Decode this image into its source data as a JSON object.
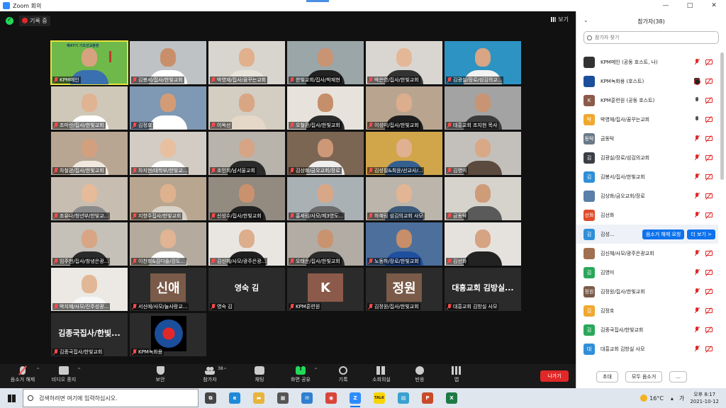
{
  "window": {
    "title": "Zoom 회의",
    "controls": [
      "—",
      "□",
      "✕"
    ]
  },
  "meeting": {
    "recording_label": "기록 중",
    "view_label": "보기",
    "active_tile_text": "제47기 기초선교훈련",
    "tiles": [
      {
        "caption": "KPM메인",
        "type": "video",
        "skin": "#d7a27f",
        "bg": "#6fb84a",
        "body": "#3a6fb0"
      },
      {
        "caption": "김봉서/집사/한빛교회",
        "type": "video",
        "skin": "#c98f6a",
        "bg": "#bfc2c4",
        "body": "#ffffff"
      },
      {
        "caption": "박영재/집사/꿈꾸는교회",
        "type": "video",
        "skin": "#e1b08c",
        "bg": "#d8d5cf",
        "body": "#e8e4dc"
      },
      {
        "caption": "한빛교회/집사/박재현",
        "type": "video",
        "skin": "#c89474",
        "bg": "#9aa6a8",
        "body": "#222222"
      },
      {
        "caption": "박은영/집사/한빛교회",
        "type": "video",
        "skin": "#e4b896",
        "bg": "#d9d6d2",
        "body": "#333333"
      },
      {
        "caption": "김광실/장로/섬김의교...",
        "type": "video",
        "skin": "#d8a585",
        "bg": "#2d93c2",
        "body": "#f2f2f2"
      },
      {
        "caption": "조미란/집사/한빛교회",
        "type": "video",
        "skin": "#e0b393",
        "bg": "#cfc8b8",
        "body": "#ffffff"
      },
      {
        "caption": "김정호",
        "type": "video",
        "skin": "#d39c77",
        "bg": "#7f98b4",
        "body": "#ffffff"
      },
      {
        "caption": "이옥선",
        "type": "video",
        "skin": "#d9a684",
        "bg": "#d3cdc2",
        "body": "#e6d8c8"
      },
      {
        "caption": "오철환/집사/한빛교회",
        "type": "video",
        "skin": "#c68f6b",
        "bg": "#e7e3dc",
        "body": "#2b2b2b"
      },
      {
        "caption": "이성미/집사/한빛교회",
        "type": "video",
        "skin": "#dcae8d",
        "bg": "#b9a58f",
        "body": "#1f1f1f"
      },
      {
        "caption": "대흥교회 조지현 목사",
        "type": "video",
        "skin": "#c99473",
        "bg": "#a3a3a3",
        "body": "#3b3b3b"
      },
      {
        "caption": "차철환/집사/한빛교회",
        "type": "video",
        "skin": "#d2a07f",
        "bg": "#b8a693",
        "body": "#f1e8df"
      },
      {
        "caption": "차지현/대학부/한빛교...",
        "type": "video",
        "skin": "#e8c0a0",
        "bg": "#d2ccc4",
        "body": "#ffffff"
      },
      {
        "caption": "조인희/남서울교회",
        "type": "video",
        "skin": "#d6a585",
        "bg": "#b8b3ab",
        "body": "#2a2a2a"
      },
      {
        "caption": "김상화/금오교회/장로",
        "type": "video",
        "skin": "#cd9878",
        "bg": "#7b6653",
        "body": "#efefef"
      },
      {
        "caption": "김성필&최윤/선교사/...",
        "type": "video",
        "skin": "#dfb190",
        "bg": "#d1a54a",
        "body": "#34608f"
      },
      {
        "caption": "김영미",
        "type": "video",
        "skin": "#d9a887",
        "bg": "#c3c0bc",
        "body": "#5b4a3e"
      },
      {
        "caption": "조유나/청년부/한빛교...",
        "type": "video",
        "skin": "#e6bb9a",
        "bg": "#c7bdb0",
        "body": "#8a8a8a"
      },
      {
        "caption": "지향주집사/한빛교회",
        "type": "video",
        "skin": "#dfb28f",
        "bg": "#b9a690",
        "body": "#d8d2c8"
      },
      {
        "caption": "신성수/집사/한빛교회",
        "type": "video",
        "skin": "#c9916e",
        "bg": "#938a80",
        "body": "#222222"
      },
      {
        "caption": "홍세림/사모/제3영도...",
        "type": "video",
        "skin": "#d8a787",
        "bg": "#aab1b5",
        "body": "#6b6b6b"
      },
      {
        "caption": "하혜림 섬김의교회 사모",
        "type": "video",
        "skin": "#e2b594",
        "bg": "#bcb5ab",
        "body": "#3c5a7a"
      },
      {
        "caption": "금동탁",
        "type": "video",
        "skin": "#cf9c7a",
        "bg": "#d6d3cd",
        "body": "#5a5a5a"
      },
      {
        "caption": "임주현/집사/창녕은광...",
        "type": "video",
        "skin": "#d8a585",
        "bg": "#c5c0b8",
        "body": "#2a2a2a"
      },
      {
        "caption": "이찬희&김다솔/강도...",
        "type": "video",
        "skin": "#e1b493",
        "bg": "#b4ab9e",
        "body": "#ffffff"
      },
      {
        "caption": "김신혜/사모/광주은광...",
        "type": "video",
        "skin": "#dcae8c",
        "bg": "#e9e6e2",
        "body": "#1f1f1f"
      },
      {
        "caption": "오태운/집사/한빛교회",
        "type": "video",
        "skin": "#c99370",
        "bg": "#b2aca4",
        "body": "#2c2c2c"
      },
      {
        "caption": "노동하/장로/한빛교회",
        "type": "video",
        "skin": "#c68e69",
        "bg": "#4d6f9c",
        "body": "#1f4f9f"
      },
      {
        "caption": "김선화",
        "type": "video",
        "skin": "#d6a383",
        "bg": "#e5e2de",
        "body": "#222222"
      },
      {
        "caption": "박지혜/사모/진주성광...",
        "type": "video",
        "skin": "#e2b796",
        "bg": "#ece9e4",
        "body": "#f7f7f7"
      },
      {
        "caption": "서신애/사모/늘사랑교...",
        "type": "avatar",
        "avatar_text": "신애",
        "avatar_bg": "#7a5a48"
      },
      {
        "caption": "영숙 김",
        "type": "name",
        "name_text": "영숙 김"
      },
      {
        "caption": "KPM훈련원",
        "type": "avatar",
        "avatar_text": "K",
        "avatar_bg": "#8c5a4a"
      },
      {
        "caption": "김정원/집사/한빛교회",
        "type": "avatar",
        "avatar_text": "정원",
        "avatar_bg": "#7a5a48"
      },
      {
        "caption": "대흥교회 김방실 사모",
        "type": "name",
        "name_text": "대흥교회 김방실..."
      },
      {
        "caption": "김종국집사/한빛교회",
        "type": "name",
        "name_text": "김종국집사/한빛..."
      },
      {
        "caption": "KPM녹화용",
        "type": "logo"
      }
    ]
  },
  "toolbar": {
    "items": [
      {
        "label": "음소거 해제",
        "icon": "mic-muted-icon",
        "caret": true
      },
      {
        "label": "비디오 중지",
        "icon": "video-camera-icon",
        "caret": true
      },
      {
        "label": "보안",
        "icon": "security-shield-icon",
        "caret": false
      },
      {
        "label": "참가자",
        "icon": "participants-icon",
        "caret": true
      },
      {
        "label": "채팅",
        "icon": "chat-icon",
        "caret": false
      },
      {
        "label": "화면 공유",
        "icon": "share-screen-icon",
        "caret": true
      },
      {
        "label": "기록",
        "icon": "record-icon",
        "caret": false
      },
      {
        "label": "소회의실",
        "icon": "breakout-rooms-icon",
        "caret": false
      },
      {
        "label": "반응",
        "icon": "reactions-icon",
        "caret": false
      },
      {
        "label": "앱",
        "icon": "apps-icon",
        "caret": false
      }
    ],
    "participants_count": "38",
    "leave_label": "나가기",
    "caret_glyph": "^"
  },
  "panel": {
    "title": "참가자(38)",
    "search_placeholder": "참가자 찾기",
    "participants": [
      {
        "name": "KPM메인 (공동 호스트, 나)",
        "avatar": "",
        "color": "#333333",
        "mic": "off",
        "cam": "off"
      },
      {
        "name": "KPM녹화용 (호스트)",
        "avatar": "",
        "color": "#1b4e9b",
        "mic": "rec",
        "cam": "off"
      },
      {
        "name": "KPM훈련원 (공동 호스트)",
        "avatar": "K",
        "color": "#8c5a4a",
        "mic": "on",
        "cam": "off"
      },
      {
        "name": "박영재/집사/꿈꾸는교회",
        "avatar": "박",
        "color": "#f0a830",
        "mic": "on",
        "cam": "off"
      },
      {
        "name": "금동탁",
        "avatar": "동탁",
        "color": "#6b7a88",
        "mic": "off",
        "cam": "off"
      },
      {
        "name": "김광실/장로/섬김의교회",
        "avatar": "김",
        "color": "#3b3f45",
        "mic": "off",
        "cam": "off"
      },
      {
        "name": "김봉서/집사/한빛교회",
        "avatar": "김",
        "color": "#2f8fd8",
        "mic": "off",
        "cam": "off"
      },
      {
        "name": "김상화/금오교회/장로",
        "avatar": "",
        "color": "#5a7fa8",
        "mic": "off",
        "cam": "off"
      },
      {
        "name": "김선화",
        "avatar": "선화",
        "color": "#e04a2a",
        "mic": "off",
        "cam": "off"
      },
      {
        "name": "김성...",
        "avatar": "김",
        "color": "#2f8fd8",
        "mic": "",
        "cam": "",
        "highlight": true,
        "actions": [
          "음소거 해제 요청",
          "더 보기 >"
        ]
      },
      {
        "name": "김신혜/사모/광주은광교회",
        "avatar": "",
        "color": "#a07050",
        "mic": "off",
        "cam": "off"
      },
      {
        "name": "김영미",
        "avatar": "김",
        "color": "#2aa85a",
        "mic": "off",
        "cam": "off"
      },
      {
        "name": "김정원/집사/한빛교회",
        "avatar": "정원",
        "color": "#7a5a48",
        "mic": "off",
        "cam": "off"
      },
      {
        "name": "김정호",
        "avatar": "김",
        "color": "#f0a830",
        "mic": "off",
        "cam": "off"
      },
      {
        "name": "김종국집사/한빛교회",
        "avatar": "김",
        "color": "#2aa85a",
        "mic": "off",
        "cam": "off"
      },
      {
        "name": "대흥교회 김방실 사모",
        "avatar": "대",
        "color": "#2f8fd8",
        "mic": "off",
        "cam": "off"
      }
    ],
    "footer": {
      "invite_label": "초대",
      "mute_all_label": "모두 음소거",
      "more_label": "..."
    }
  },
  "taskbar": {
    "search_placeholder": "검색하려면 여기에 입력하십시오.",
    "apps": [
      {
        "name": "task-view",
        "glyph": "⧉",
        "color": "#444444"
      },
      {
        "name": "edge",
        "glyph": "e",
        "color": "#1f8ad8"
      },
      {
        "name": "file-explorer",
        "glyph": "▬",
        "color": "#e8b43a"
      },
      {
        "name": "store",
        "glyph": "▦",
        "color": "#555555"
      },
      {
        "name": "mail",
        "glyph": "✉",
        "color": "#2f7fd0"
      },
      {
        "name": "chrome",
        "glyph": "◉",
        "color": "#d9453a"
      },
      {
        "name": "zoom",
        "glyph": "Z",
        "color": "#2d8cff",
        "running": true
      },
      {
        "name": "kakaotalk",
        "glyph": "TALK",
        "color": "#f7d600"
      },
      {
        "name": "files",
        "glyph": "▤",
        "color": "#3aa0d0"
      },
      {
        "name": "powerpoint",
        "glyph": "P",
        "color": "#c94a2a"
      },
      {
        "name": "excel",
        "glyph": "X",
        "color": "#1e7a45"
      }
    ],
    "temperature": "16°C",
    "ime": "가",
    "clock_time": "오후 8:17",
    "clock_date": "2021-10-12"
  }
}
